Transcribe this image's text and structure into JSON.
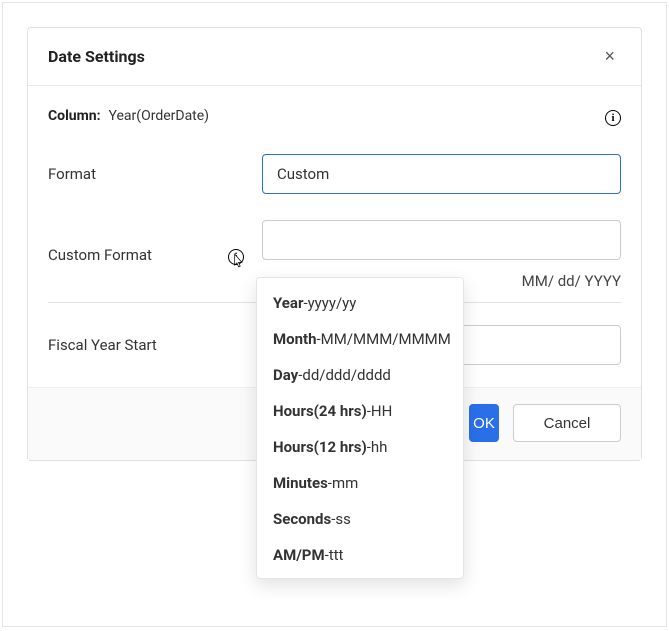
{
  "dialog": {
    "title": "Date Settings",
    "close": "×",
    "column_label": "Column:",
    "column_value": "Year(OrderDate)",
    "format_label": "Format",
    "format_value": "Custom",
    "custom_label": "Custom Format",
    "custom_value": "",
    "custom_hint": "MM/ dd/ YYYY",
    "fiscal_label": "Fiscal Year Start",
    "fiscal_value": "",
    "buttons": {
      "ok": "OK",
      "cancel": "Cancel"
    }
  },
  "tooltip": {
    "items": [
      {
        "strong": "Year",
        "rest": "-yyyy/yy"
      },
      {
        "strong": "Month",
        "rest": "-MM/MMM/MMMM"
      },
      {
        "strong": "Day",
        "rest": "-dd/ddd/dddd"
      },
      {
        "strong": "Hours(24 hrs)",
        "rest": "-HH"
      },
      {
        "strong": "Hours(12 hrs)",
        "rest": "-hh"
      },
      {
        "strong": "Minutes",
        "rest": "-mm"
      },
      {
        "strong": "Seconds",
        "rest": "-ss"
      },
      {
        "strong": "AM/PM",
        "rest": "-ttt"
      }
    ]
  }
}
